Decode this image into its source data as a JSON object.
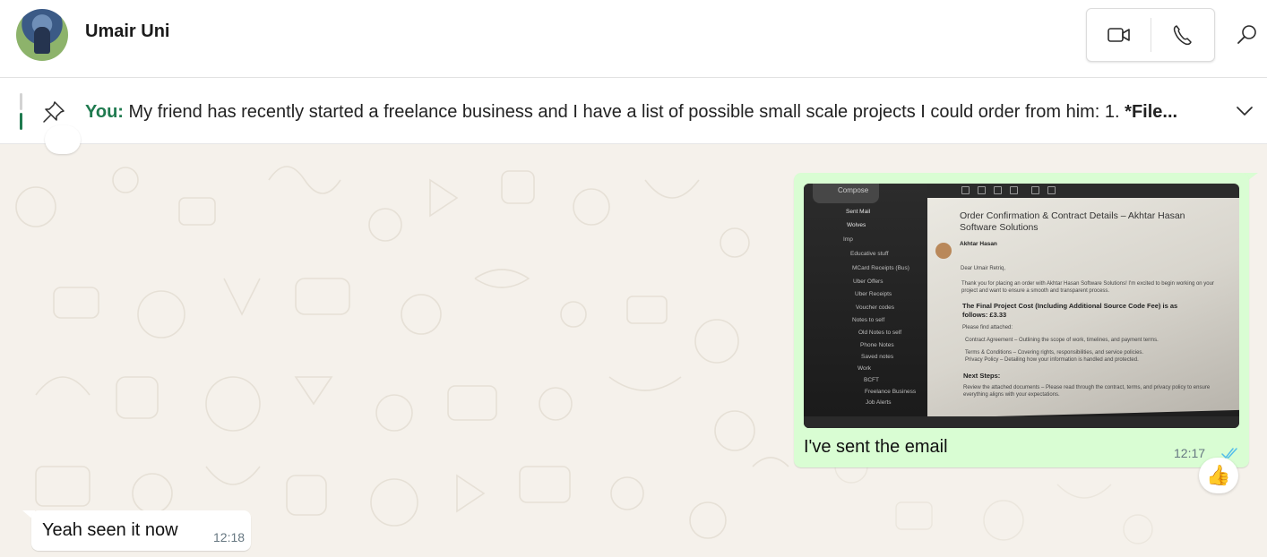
{
  "contact": {
    "name": "Umair Uni"
  },
  "header": {
    "video_icon": "video-camera-icon",
    "voice_icon": "phone-icon",
    "search_icon": "search-icon"
  },
  "pinned": {
    "author": "You:",
    "text": "My friend has recently started a freelance business and I have a list of possible small scale projects I could order from him: 1. ",
    "text_bold": "*File...",
    "pin_icon": "pin-icon",
    "expand_icon": "chevron-down-icon"
  },
  "messages": {
    "outgoing": {
      "text": "I've sent the email",
      "time": "12:17",
      "status_icon": "double-check-read-icon",
      "status_color": "#53bdeb",
      "reaction": "👍",
      "photo": {
        "compose": "Compose",
        "folders": [
          "Sent Mail",
          "Wolves",
          "Imp",
          "Educative stuff",
          "MCard Receipts (Bus)",
          "Uber Offers",
          "Uber Receipts",
          "Voucher codes",
          "Notes to self",
          "Old Notes to self",
          "Phone Notes",
          "Saved notes",
          "Work",
          "BCFT",
          "Freelance Business",
          "Job Alerts"
        ],
        "subject": "Order Confirmation & Contract Details – Akhtar Hasan Software Solutions",
        "sender": "Akhtar Hasan",
        "greeting": "Dear Umair Retriq,",
        "intro": "Thank you for placing an order with Akhtar Hasan Software Solutions! I'm excited to begin working on your project and want to ensure a smooth and transparent process.",
        "cost_heading": "The Final Project Cost (Including Additional Source Code Fee) is as follows: £3.33",
        "attached": "Please find attached:",
        "attach_1": "Contract Agreement – Outlining the scope of work, timelines, and payment terms.",
        "attach_2": "Terms & Conditions – Covering rights, responsibilities, and service policies.",
        "attach_3": "Privacy Policy – Detailing how your information is handled and protected.",
        "next_steps": "Next Steps:",
        "step_1": "Review the attached documents – Please read through the contract, terms, and privacy policy to ensure everything aligns with your expectations."
      }
    },
    "incoming": {
      "text": "Yeah seen it now",
      "time": "12:18"
    }
  },
  "colors": {
    "accent_green": "#1f7a4f",
    "outgoing_bubble": "#d9fdd3",
    "incoming_bubble": "#ffffff",
    "chat_background": "#f5f1eb"
  }
}
